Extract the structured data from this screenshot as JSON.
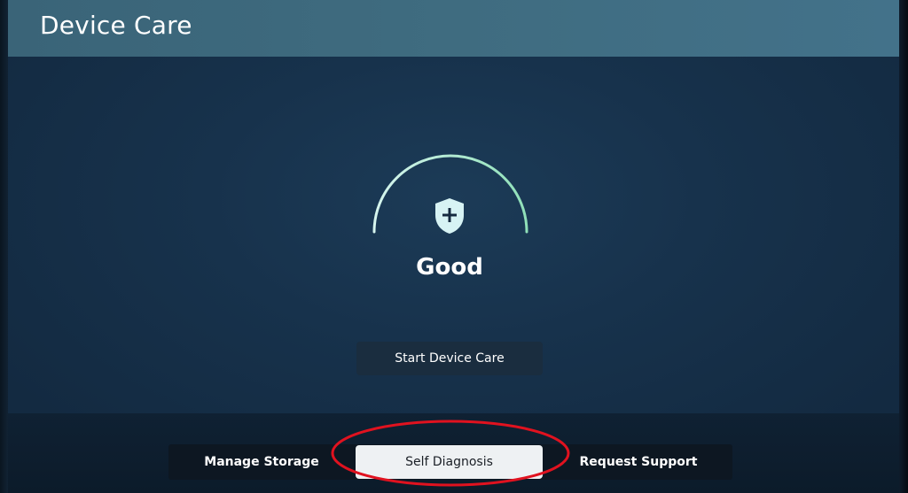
{
  "header": {
    "title": "Device Care"
  },
  "status": {
    "label": "Good",
    "icon": "shield-plus-icon"
  },
  "actions": {
    "start_label": "Start Device Care"
  },
  "tabs": [
    {
      "label": "Manage Storage",
      "selected": false
    },
    {
      "label": "Self Diagnosis",
      "selected": true
    },
    {
      "label": "Request Support",
      "selected": false
    }
  ],
  "colors": {
    "gauge_start": "#d6f5ee",
    "gauge_end": "#8fe0b8",
    "shield": "#d7f3f4",
    "highlight": "#e0121f"
  }
}
